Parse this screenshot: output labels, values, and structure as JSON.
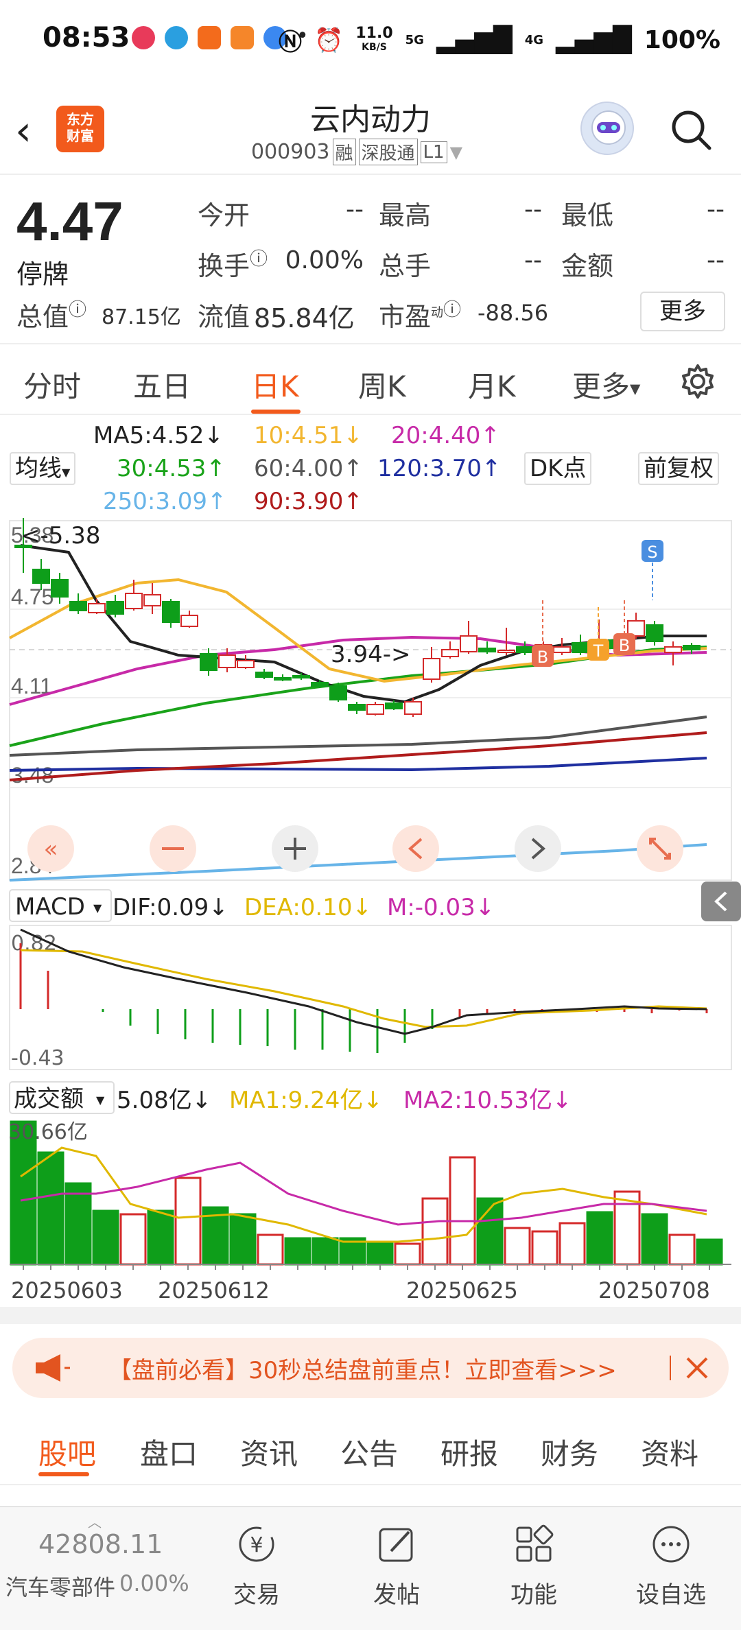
{
  "status": {
    "time": "08:53",
    "net_speed": "11.0",
    "net_unit": "KB/S",
    "battery": "100%",
    "signal1": "5G",
    "signal2": "4G"
  },
  "header": {
    "logo_text": "东方\n财富",
    "name": "云内动力",
    "code": "000903",
    "tags": [
      "融",
      "深股通",
      "L1"
    ]
  },
  "quote": {
    "price": "4.47",
    "status": "停牌",
    "fields": [
      {
        "label": "今开",
        "value": "--"
      },
      {
        "label": "最高",
        "value": "--"
      },
      {
        "label": "最低",
        "value": "--"
      },
      {
        "label": "换手",
        "value": "0.00%"
      },
      {
        "label": "总手",
        "value": "--"
      },
      {
        "label": "金额",
        "value": "--"
      }
    ],
    "market_cap_label": "总值",
    "market_cap": "87.15亿",
    "float_cap_label": "流值",
    "float_cap": "85.84亿",
    "pe_label": "市盈",
    "pe_sup": "动",
    "pe": "-88.56",
    "more": "更多"
  },
  "tabs": [
    "分时",
    "五日",
    "日K",
    "周K",
    "月K",
    "更多"
  ],
  "active_tab": "日K",
  "ma": {
    "selector": "均线",
    "items": [
      {
        "text": "MA5:4.52↓",
        "color": "#222222"
      },
      {
        "text": "10:4.51↓",
        "color": "#f2b630"
      },
      {
        "text": "20:4.40↑",
        "color": "#c72aa8"
      },
      {
        "text": "30:4.53↑",
        "color": "#1aa31a"
      },
      {
        "text": "60:4.00↑",
        "color": "#555555"
      },
      {
        "text": "120:3.70↑",
        "color": "#1f2fa0"
      },
      {
        "text": "250:3.09↑",
        "color": "#67b4e8"
      },
      {
        "text": "90:3.90↑",
        "color": "#b01c1c"
      }
    ],
    "dk": "DK点",
    "adjust": "前复权"
  },
  "kline": {
    "axis_labels": [
      "5.38",
      "4.75",
      "4.11",
      "3.48",
      "2.84"
    ],
    "high_label": "<-5.38",
    "low_label": "3.94->",
    "signals": [
      "S",
      "B",
      "T",
      "B"
    ]
  },
  "macd": {
    "selector": "MACD",
    "dif": "DIF:0.09↓",
    "dea": "DEA:0.10↓",
    "m": "M:-0.03↓",
    "axis_top": "0.82",
    "axis_bottom": "-0.43"
  },
  "volume": {
    "selector": "成交额",
    "value": "5.08亿↓",
    "ma1": "MA1:9.24亿↓",
    "ma2": "MA2:10.53亿↓",
    "axis_top": "30.66亿",
    "dates": [
      "20250603",
      "20250612",
      "20250625",
      "20250708"
    ]
  },
  "banner": {
    "text": "【盘前必看】30秒总结盘前重点！立即查看>>>"
  },
  "subtabs": [
    "股吧",
    "盘口",
    "资讯",
    "公告",
    "研报",
    "财务",
    "资料"
  ],
  "active_subtab": "股吧",
  "bottom": {
    "index_value": "42808.11",
    "index_name": "汽车零部件",
    "index_change": "0.00%",
    "nav": [
      "交易",
      "发帖",
      "功能",
      "设自选"
    ]
  },
  "colors": {
    "accent": "#f25a1c",
    "up": "#d42a2a",
    "down": "#0e9e1a"
  }
}
